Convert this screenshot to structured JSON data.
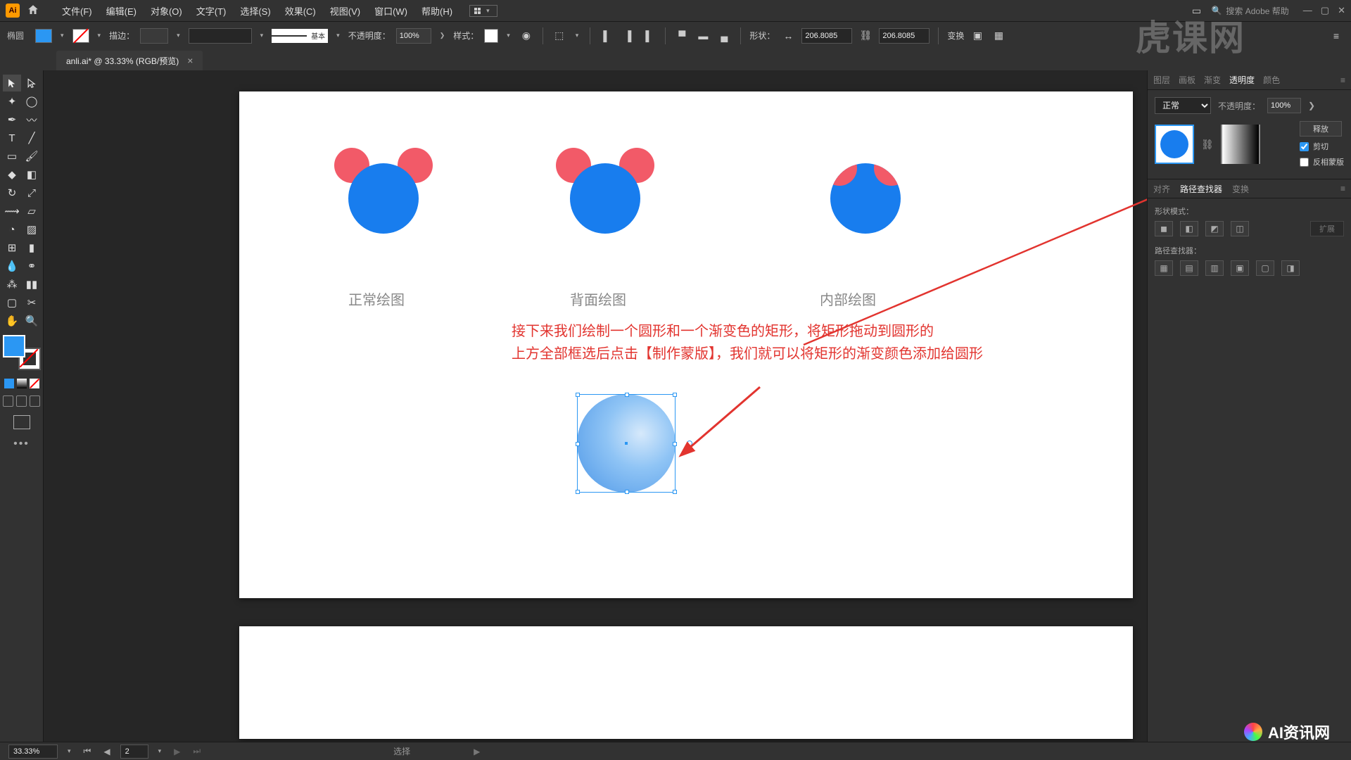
{
  "menu": {
    "file": "文件(F)",
    "edit": "编辑(E)",
    "object": "对象(O)",
    "type": "文字(T)",
    "select": "选择(S)",
    "effect": "效果(C)",
    "view": "视图(V)",
    "window": "窗口(W)",
    "help": "帮助(H)"
  },
  "search_placeholder": "搜索 Adobe 帮助",
  "control": {
    "tool_name": "椭圆",
    "stroke_label": "描边：",
    "stroke_profile": "基本",
    "opacity_label": "不透明度：",
    "opacity_value": "100%",
    "style_label": "样式：",
    "shape_label": "形状：",
    "transform_label": "变换",
    "x_value": "206.8085",
    "y_value": "206.8085"
  },
  "doc_tab": "anli.ai* @ 33.33% (RGB/预览)",
  "canvas": {
    "label_normal": "正常绘图",
    "label_behind": "背面绘图",
    "label_inside": "内部绘图",
    "instruction_line1": "接下来我们绘制一个圆形和一个渐变色的矩形，将矩形拖动到圆形的",
    "instruction_line2": "上方全部框选后点击【制作蒙版】，我们就可以将矩形的渐变颜色添加给圆形"
  },
  "panels": {
    "tabs": {
      "layers": "图层",
      "artboards": "画板",
      "gradient": "渐变",
      "transparency": "透明度",
      "color": "颜色"
    },
    "blend_mode": "正常",
    "opacity_label": "不透明度：",
    "opacity_value": "100%",
    "release": "释放",
    "clip": "剪切",
    "invert": "反相蒙版",
    "align": "对齐",
    "pathfinder": "路径查找器",
    "transform": "变换",
    "shape_mode": "形状模式：",
    "expand": "扩展",
    "pathfinder_label": "路径查找器："
  },
  "status": {
    "zoom": "33.33%",
    "page": "2",
    "mode": "选择"
  },
  "watermark_text": "虎课网",
  "bottom_logo": "AI资讯网"
}
